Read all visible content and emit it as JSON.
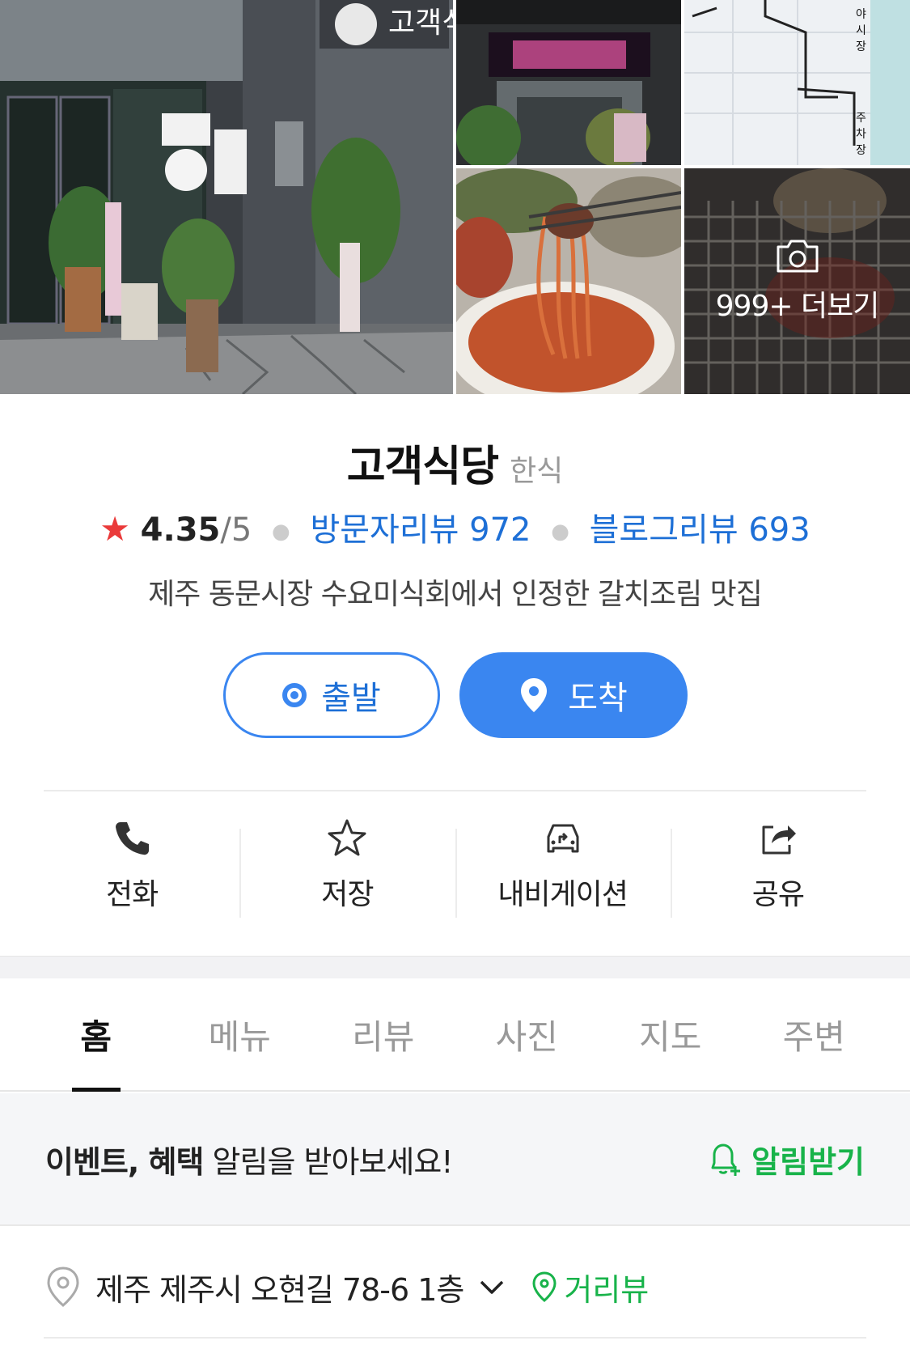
{
  "gallery": {
    "more_label": "999+ 더보기",
    "storefront_sign": "고객식당",
    "map_labels": [
      "야",
      "시",
      "장",
      "주",
      "차",
      "장"
    ],
    "more_icon": "camera-icon"
  },
  "place": {
    "name": "고객식당",
    "category": "한식",
    "rating_star": "★",
    "rating": "4.35",
    "rating_max": "/5",
    "visitor_reviews": "방문자리뷰 972",
    "blog_reviews": "블로그리뷰 693",
    "description": "제주 동문시장 수요미식회에서 인정한 갈치조림 맛집"
  },
  "route": {
    "depart_label": "출발",
    "arrive_label": "도착"
  },
  "actions": [
    {
      "label": "전화",
      "icon": "phone-icon"
    },
    {
      "label": "저장",
      "icon": "star-icon"
    },
    {
      "label": "내비게이션",
      "icon": "car-navigation-icon"
    },
    {
      "label": "공유",
      "icon": "share-icon"
    }
  ],
  "tabs": [
    {
      "label": "홈",
      "active": true
    },
    {
      "label": "메뉴"
    },
    {
      "label": "리뷰"
    },
    {
      "label": "사진"
    },
    {
      "label": "지도"
    },
    {
      "label": "주변"
    }
  ],
  "notice": {
    "bold_text": "이벤트, 혜택",
    "text": " 알림을 받아보세요!",
    "button_label": "알림받기"
  },
  "address": {
    "text": "제주 제주시 오현길 78-6 1층",
    "street_view_label": "거리뷰"
  },
  "colors": {
    "accent_blue": "#3a86f0",
    "link_blue": "#1d6fd6",
    "green": "#18b34a",
    "star_red": "#ea3a3a"
  }
}
